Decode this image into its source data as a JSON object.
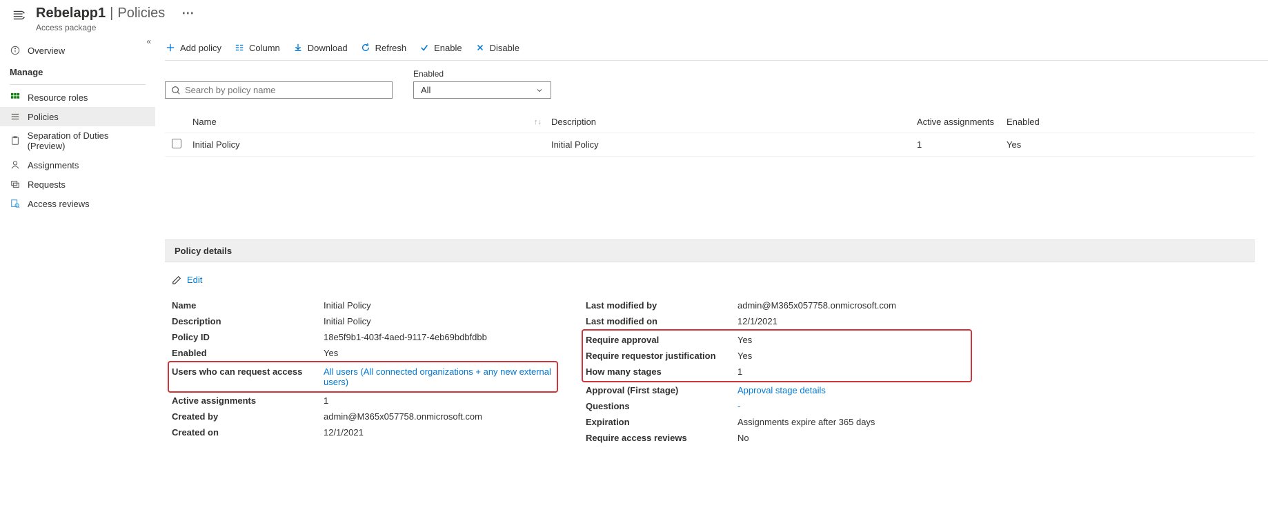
{
  "header": {
    "title_left": "Rebelapp1",
    "title_sep": "|",
    "title_right": "Policies",
    "subtitle": "Access package"
  },
  "sidebar": {
    "overview": "Overview",
    "manage_label": "Manage",
    "resource_roles": "Resource roles",
    "policies": "Policies",
    "separation": "Separation of Duties (Preview)",
    "assignments": "Assignments",
    "requests": "Requests",
    "access_reviews": "Access reviews"
  },
  "toolbar": {
    "add_policy": "Add policy",
    "column": "Column",
    "download": "Download",
    "refresh": "Refresh",
    "enable": "Enable",
    "disable": "Disable"
  },
  "filters": {
    "search_placeholder": "Search by policy name",
    "enabled_label": "Enabled",
    "enabled_value": "All"
  },
  "grid": {
    "headers": {
      "name": "Name",
      "desc": "Description",
      "active": "Active assignments",
      "enabled": "Enabled"
    },
    "rows": [
      {
        "name": "Initial Policy",
        "desc": "Initial Policy",
        "active": "1",
        "enabled": "Yes"
      }
    ]
  },
  "details": {
    "bar_title": "Policy details",
    "edit_label": "Edit",
    "left": {
      "name_k": "Name",
      "name_v": "Initial Policy",
      "desc_k": "Description",
      "desc_v": "Initial Policy",
      "id_k": "Policy ID",
      "id_v": "18e5f9b1-403f-4aed-9117-4eb69bdbfdbb",
      "enabled_k": "Enabled",
      "enabled_v": "Yes",
      "users_k": "Users who can request access",
      "users_v": "All users (All connected organizations + any new external users)",
      "active_k": "Active assignments",
      "active_v": "1",
      "createdby_k": "Created by",
      "createdby_v": "admin@M365x057758.onmicrosoft.com",
      "createdon_k": "Created on",
      "createdon_v": "12/1/2021"
    },
    "right": {
      "modby_k": "Last modified by",
      "modby_v": "admin@M365x057758.onmicrosoft.com",
      "modon_k": "Last modified on",
      "modon_v": "12/1/2021",
      "reqappr_k": "Require approval",
      "reqappr_v": "Yes",
      "reqjust_k": "Require requestor justification",
      "reqjust_v": "Yes",
      "stages_k": "How many stages",
      "stages_v": "1",
      "approval_k": "Approval (First stage)",
      "approval_v": "Approval stage details",
      "questions_k": "Questions",
      "questions_v": "-",
      "expiration_k": "Expiration",
      "expiration_v": "Assignments expire after 365 days",
      "reviews_k": "Require access reviews",
      "reviews_v": "No"
    }
  }
}
